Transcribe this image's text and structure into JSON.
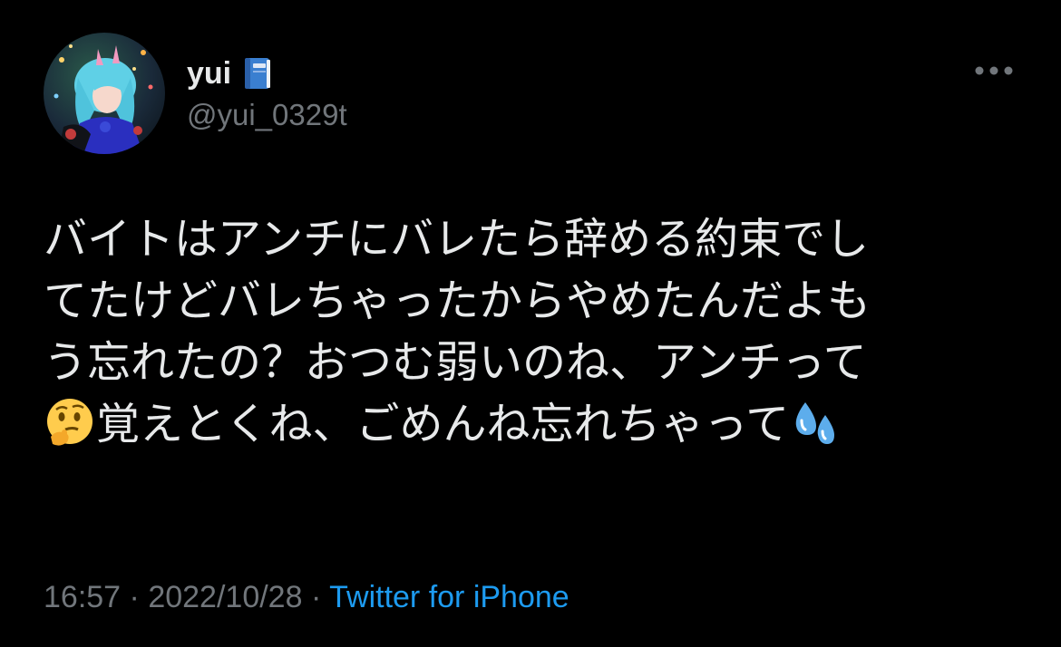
{
  "tweet": {
    "author": {
      "display_name": "yui",
      "handle": "@yui_0329t",
      "name_badge_icon": "blue-book-emoji",
      "avatar_icon": "profile-photo"
    },
    "more_icon": "more-horizontal-icon",
    "text_lines": [
      "バイトはアンチにバレたら辞める約束でし",
      "てたけどバレちゃったからやめたんだよも",
      "う忘れたの？おつむ弱いのね、アンチって",
      "覚えとくね、ごめんね忘れちゃって"
    ],
    "emojis": {
      "thinking": "thinking-face-emoji",
      "sweat": "sweat-droplets-emoji"
    },
    "time": "16:57",
    "separator": "·",
    "date": "2022/10/28",
    "source": "Twitter for iPhone"
  },
  "colors": {
    "background": "#000000",
    "primary_text": "#e7e9ea",
    "secondary_text": "#71767b",
    "link": "#1d9bf0"
  }
}
